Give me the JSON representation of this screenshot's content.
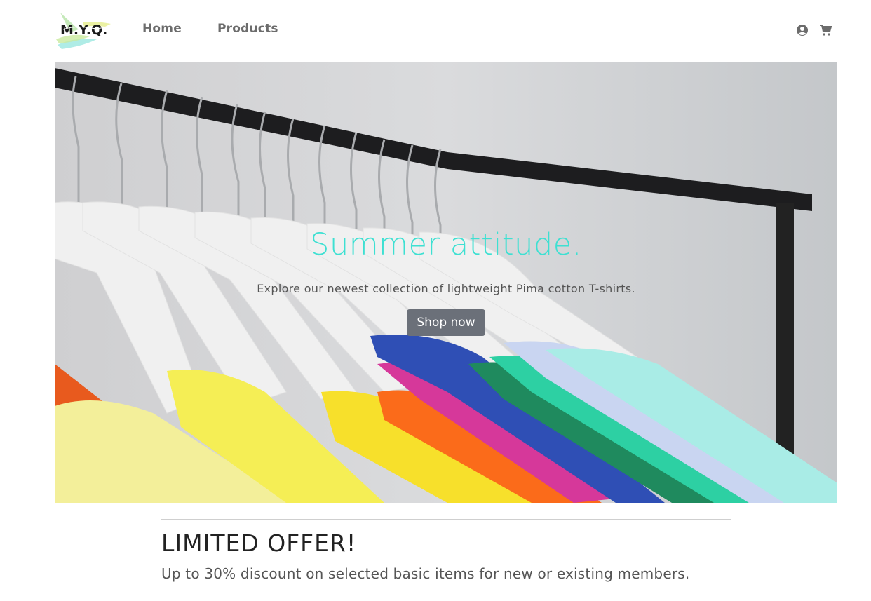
{
  "brand": {
    "logo_text": "M.Y.Q."
  },
  "nav": {
    "home_label": "Home",
    "products_label": "Products"
  },
  "icons": {
    "account": "user-circle-icon",
    "cart": "shopping-cart-icon"
  },
  "hero": {
    "title": "Summer attitude.",
    "subtitle": "Explore our newest collection of lightweight Pima cotton T-shirts.",
    "button_label": "Shop now"
  },
  "offer": {
    "title": "LIMITED OFFER!",
    "text": "Up to 30% discount on selected basic items for new or existing members."
  },
  "colors": {
    "accent": "#3de0d2",
    "button_bg": "#6b7079",
    "nav_text": "#6c6c6c"
  }
}
